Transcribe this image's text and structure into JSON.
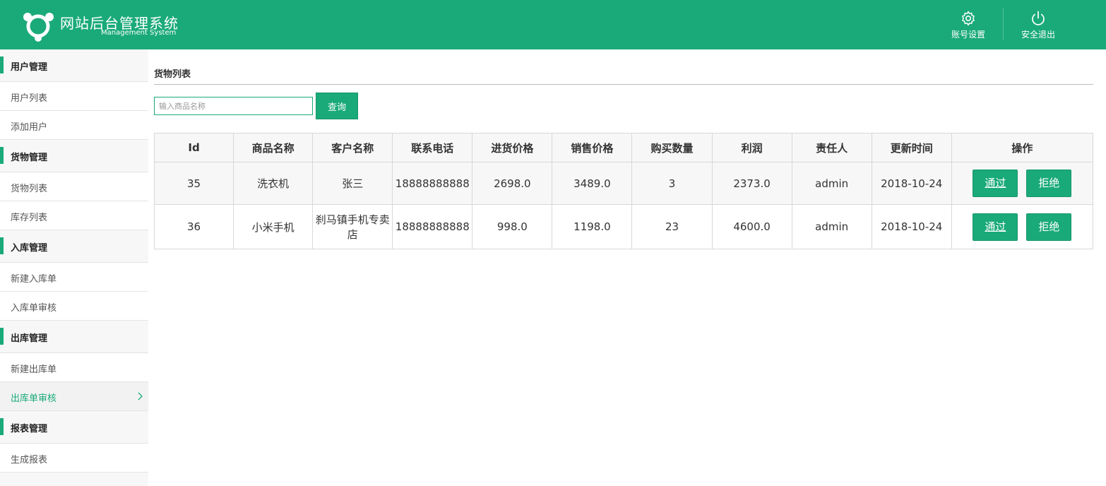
{
  "header": {
    "title": "网站后台管理系统",
    "subtitle": "Management System",
    "account_settings": "账号设置",
    "logout": "安全退出",
    "colors": {
      "primary": "#1aaa7a"
    }
  },
  "sidebar": {
    "groups": [
      {
        "label": "用户管理",
        "items": [
          "用户列表",
          "添加用户"
        ]
      },
      {
        "label": "货物管理",
        "items": [
          "货物列表",
          "库存列表"
        ]
      },
      {
        "label": "入库管理",
        "items": [
          "新建入库单",
          "入库单审核"
        ]
      },
      {
        "label": "出库管理",
        "items": [
          "新建出库单",
          "出库单审核"
        ]
      },
      {
        "label": "报表管理",
        "items": [
          "生成报表"
        ]
      }
    ],
    "active_item": "出库单审核"
  },
  "main": {
    "page_title": "货物列表",
    "search": {
      "placeholder": "输入商品名称",
      "value": "",
      "button": "查询"
    },
    "table": {
      "headers": [
        "Id",
        "商品名称",
        "客户名称",
        "联系电话",
        "进货价格",
        "销售价格",
        "购买数量",
        "利润",
        "责任人",
        "更新时间",
        "操作"
      ],
      "rows": [
        {
          "id": "35",
          "product": "洗衣机",
          "customer": "张三",
          "phone": "18888888888",
          "purchase_price": "2698.0",
          "sale_price": "3489.0",
          "quantity": "3",
          "profit": "2373.0",
          "owner": "admin",
          "updated": "2018-10-24"
        },
        {
          "id": "36",
          "product": "小米手机",
          "customer": "刹马镇手机专卖店",
          "phone": "18888888888",
          "purchase_price": "998.0",
          "sale_price": "1198.0",
          "quantity": "23",
          "profit": "4600.0",
          "owner": "admin",
          "updated": "2018-10-24"
        }
      ],
      "actions": {
        "approve": "通过",
        "reject": "拒绝"
      }
    }
  }
}
